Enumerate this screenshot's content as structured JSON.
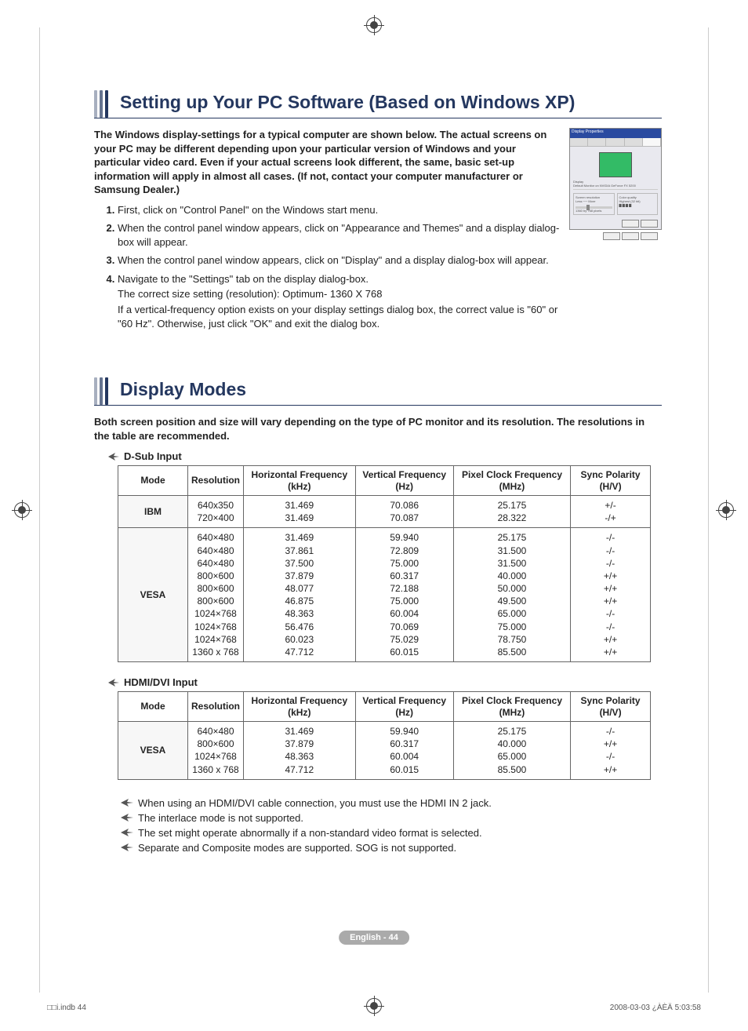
{
  "section1": {
    "title": "Setting up Your PC Software (Based on Windows XP)",
    "intro": "The Windows display-settings for a typical computer are shown below. The actual screens on your PC may be different depending upon your particular version of Windows and your particular video card. Even if your actual screens look different, the same, basic set-up information will apply in almost all cases. (If not, contact your computer manufacturer or Samsung Dealer.)",
    "steps": {
      "s1": "First, click on \"Control Panel\" on the Windows start menu.",
      "s2": "When the control panel window appears, click on \"Appearance and Themes\" and a display dialog-box will appear.",
      "s3": "When the control panel window appears, click on \"Display\" and a display dialog-box will appear.",
      "s4a": "Navigate to the \"Settings\" tab on the display dialog-box.",
      "s4b": "The correct size setting (resolution): Optimum- 1360 X 768",
      "s4c": "If a vertical-frequency option exists on your display settings dialog box, the correct value is \"60\" or \"60 Hz\". Otherwise, just click \"OK\" and exit the dialog box."
    }
  },
  "section2": {
    "title": "Display Modes",
    "intro": "Both screen position and size will vary depending on the type of PC monitor and its resolution. The resolutions in the table are recommended.",
    "dsub_label": "D-Sub Input",
    "hdmi_label": "HDMI/DVI Input",
    "headers": {
      "mode": "Mode",
      "res": "Resolution",
      "hfreq": "Horizontal Frequency (kHz)",
      "vfreq": "Vertical Frequency (Hz)",
      "pclk": "Pixel Clock Frequency (MHz)",
      "sync": "Sync Polarity (H/V)"
    }
  },
  "chart_data": [
    {
      "type": "table",
      "title": "D-Sub Input",
      "columns": [
        "Mode",
        "Resolution",
        "Horizontal Frequency (kHz)",
        "Vertical Frequency (Hz)",
        "Pixel Clock Frequency (MHz)",
        "Sync Polarity (H/V)"
      ],
      "groups": [
        {
          "mode": "IBM",
          "rows": [
            {
              "res": "640x350",
              "hf": "31.469",
              "vf": "70.086",
              "pc": "25.175",
              "sp": "+/-"
            },
            {
              "res": "720×400",
              "hf": "31.469",
              "vf": "70.087",
              "pc": "28.322",
              "sp": "-/+"
            }
          ]
        },
        {
          "mode": "VESA",
          "rows": [
            {
              "res": "640×480",
              "hf": "31.469",
              "vf": "59.940",
              "pc": "25.175",
              "sp": "-/-"
            },
            {
              "res": "640×480",
              "hf": "37.861",
              "vf": "72.809",
              "pc": "31.500",
              "sp": "-/-"
            },
            {
              "res": "640×480",
              "hf": "37.500",
              "vf": "75.000",
              "pc": "31.500",
              "sp": "-/-"
            },
            {
              "res": "800×600",
              "hf": "37.879",
              "vf": "60.317",
              "pc": "40.000",
              "sp": "+/+"
            },
            {
              "res": "800×600",
              "hf": "48.077",
              "vf": "72.188",
              "pc": "50.000",
              "sp": "+/+"
            },
            {
              "res": "800×600",
              "hf": "46.875",
              "vf": "75.000",
              "pc": "49.500",
              "sp": "+/+"
            },
            {
              "res": "1024×768",
              "hf": "48.363",
              "vf": "60.004",
              "pc": "65.000",
              "sp": "-/-"
            },
            {
              "res": "1024×768",
              "hf": "56.476",
              "vf": "70.069",
              "pc": "75.000",
              "sp": "-/-"
            },
            {
              "res": "1024×768",
              "hf": "60.023",
              "vf": "75.029",
              "pc": "78.750",
              "sp": "+/+"
            },
            {
              "res": "1360 x 768",
              "hf": "47.712",
              "vf": "60.015",
              "pc": "85.500",
              "sp": "+/+"
            }
          ]
        }
      ]
    },
    {
      "type": "table",
      "title": "HDMI/DVI Input",
      "columns": [
        "Mode",
        "Resolution",
        "Horizontal Frequency (kHz)",
        "Vertical Frequency (Hz)",
        "Pixel Clock Frequency (MHz)",
        "Sync Polarity (H/V)"
      ],
      "groups": [
        {
          "mode": "VESA",
          "rows": [
            {
              "res": "640×480",
              "hf": "31.469",
              "vf": "59.940",
              "pc": "25.175",
              "sp": "-/-"
            },
            {
              "res": "800×600",
              "hf": "37.879",
              "vf": "60.317",
              "pc": "40.000",
              "sp": "+/+"
            },
            {
              "res": "1024×768",
              "hf": "48.363",
              "vf": "60.004",
              "pc": "65.000",
              "sp": "-/-"
            },
            {
              "res": "1360 x 768",
              "hf": "47.712",
              "vf": "60.015",
              "pc": "85.500",
              "sp": "+/+"
            }
          ]
        }
      ]
    }
  ],
  "notes": {
    "n1": "When using an HDMI/DVI cable connection, you must use the HDMI IN 2 jack.",
    "n2": "The interlace mode is not supported.",
    "n3": "The set might operate abnormally if a non-standard video format is selected.",
    "n4": "Separate and Composite modes are supported. SOG is not supported."
  },
  "footer": {
    "pagebadge": "English - 44",
    "left": "□□i.indb   44",
    "right": "2008-03-03   ¿ÀÈÄ 5:03:58"
  }
}
